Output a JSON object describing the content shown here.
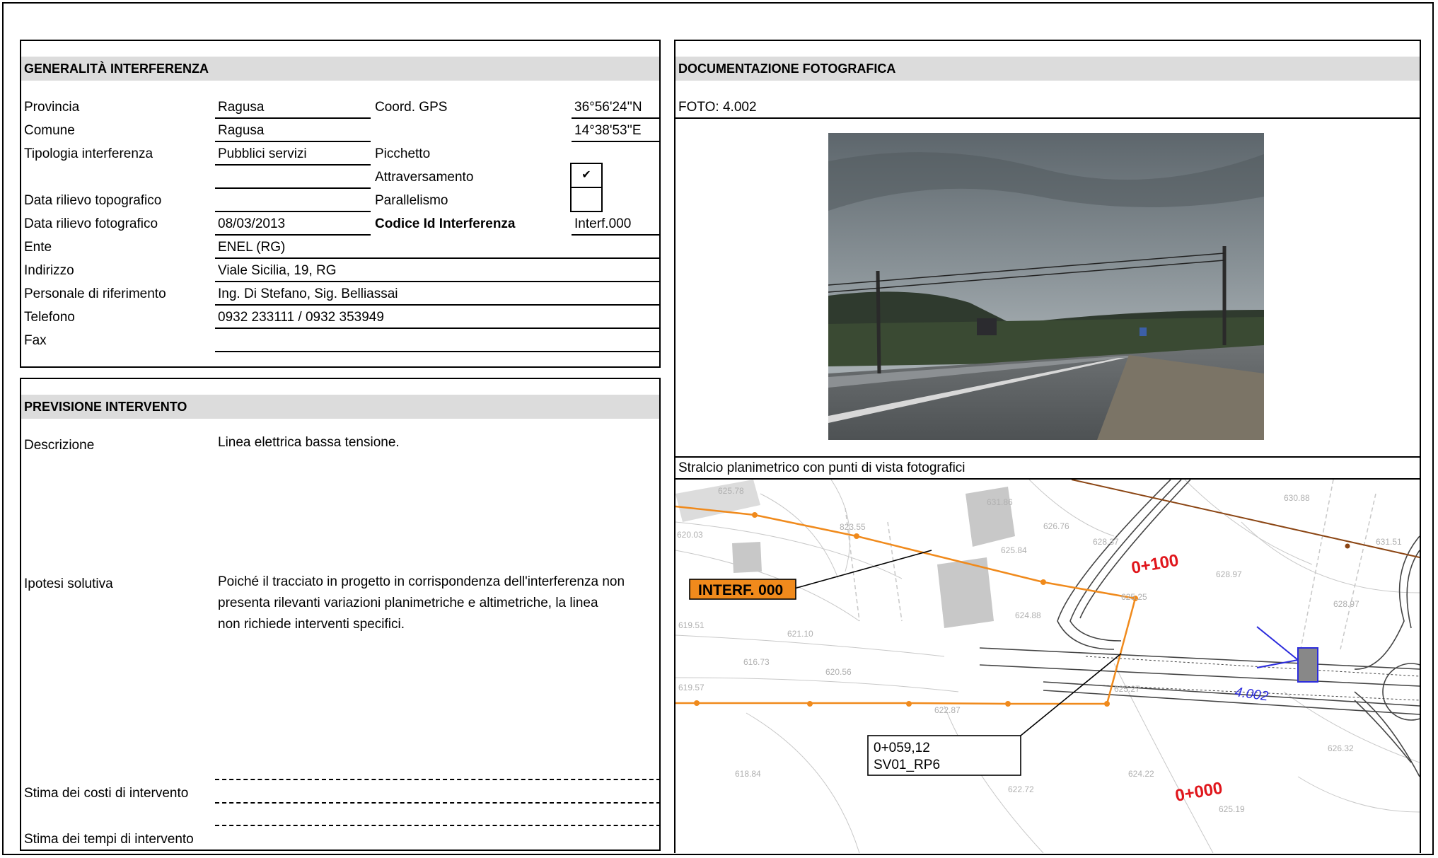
{
  "left_top": {
    "title": "GENERALITÀ  INTERFERENZA",
    "provincia_label": "Provincia",
    "provincia_value": "Ragusa",
    "comune_label": "Comune",
    "comune_value": "Ragusa",
    "coord_label": "Coord. GPS",
    "coord_n": "36°56'24''N",
    "coord_e": "14°38'53''E",
    "tipologia_label": "Tipologia interferenza",
    "tipologia_value": "Pubblici servizi",
    "picchetto_label": "Picchetto",
    "attraversamento_label": "Attraversamento",
    "attraversamento_mark": "✔",
    "parallelismo_label": "Parallelismo",
    "data_topo_label": "Data rilievo topografico",
    "data_foto_label": "Data rilievo fotografico",
    "data_foto_value": "08/03/2013",
    "codice_label": "Codice Id Interferenza",
    "codice_value": "Interf.000",
    "ente_label": "Ente",
    "ente_value": "ENEL (RG)",
    "indirizzo_label": "Indirizzo",
    "indirizzo_value": "Viale Sicilia, 19, RG",
    "personale_label": "Personale di riferimento",
    "personale_value": "Ing. Di Stefano, Sig. Belliassai",
    "telefono_label": "Telefono",
    "telefono_value": "0932 233111 / 0932 353949",
    "fax_label": "Fax"
  },
  "left_bottom": {
    "title": "PREVISIONE INTERVENTO",
    "descrizione_label": "Descrizione",
    "descrizione_value": "Linea elettrica bassa tensione.",
    "ipotesi_label": "Ipotesi solutiva",
    "ipotesi_line1": "Poiché il tracciato in progetto in corrispondenza dell'interferenza non",
    "ipotesi_line2": "presenta rilevanti variazioni planimetriche e altimetriche, la linea",
    "ipotesi_line3": "non richiede interventi specifici.",
    "costi_label": "Stima dei costi di intervento",
    "tempi_label": "Stima dei tempi di intervento"
  },
  "right": {
    "title": "DOCUMENTAZIONE FOTOGRAFICA",
    "foto_label": "FOTO: 4.002",
    "stralcio_label": "Stralcio planimetrico con punti di vista fotografici",
    "map": {
      "interf_label": "INTERF. 000",
      "ch_100": "0+100",
      "ch_000": "0+000",
      "view_label": "4.002",
      "callout_line1": "0+059,12",
      "callout_line2": "SV01_RP6",
      "spot_heights": [
        "823.55",
        "625.84",
        "626.76",
        "628.37",
        "630.88",
        "631.51",
        "628.97",
        "628.97",
        "620.56",
        "622.87",
        "619.57",
        "616.73",
        "625.27",
        "618.84",
        "622.72",
        "624.22",
        "625.19",
        "626.32",
        "631.86",
        "620.03",
        "619.51",
        "621.10",
        "625.25",
        "624.88",
        "625.78"
      ],
      "colors": {
        "orange": "#f08a1c",
        "brown": "#8b4513",
        "red": "#e0161c",
        "blue": "#2b2bdc",
        "grey": "#b8b8b8"
      }
    }
  }
}
